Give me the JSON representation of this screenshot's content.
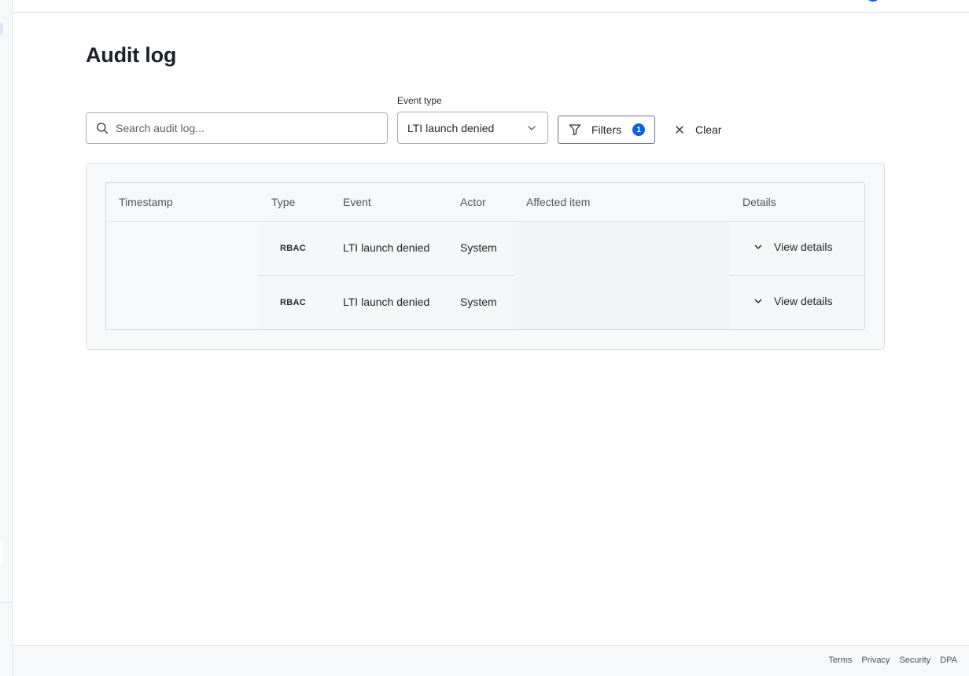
{
  "page": {
    "title": "Audit log"
  },
  "search": {
    "placeholder": "Search audit log..."
  },
  "event_type": {
    "label": "Event type",
    "selected": "LTI launch denied"
  },
  "filters": {
    "label": "Filters",
    "count": "1"
  },
  "clear": {
    "label": "Clear"
  },
  "table": {
    "columns": [
      "Timestamp",
      "Type",
      "Event",
      "Actor",
      "Affected item",
      "Details"
    ],
    "rows": [
      {
        "timestamp": "",
        "type": "RBAC",
        "event": "LTI launch denied",
        "actor": "System",
        "affected_item": "",
        "details": "View details"
      },
      {
        "timestamp": "",
        "type": "RBAC",
        "event": "LTI launch denied",
        "actor": "System",
        "affected_item": "",
        "details": "View details"
      }
    ]
  },
  "footer": {
    "links": [
      "Terms",
      "Privacy",
      "Security",
      "DPA"
    ]
  },
  "colors": {
    "accent": "#0b64c8",
    "border": "#a8adb4",
    "surface": "#f7f8fa"
  }
}
